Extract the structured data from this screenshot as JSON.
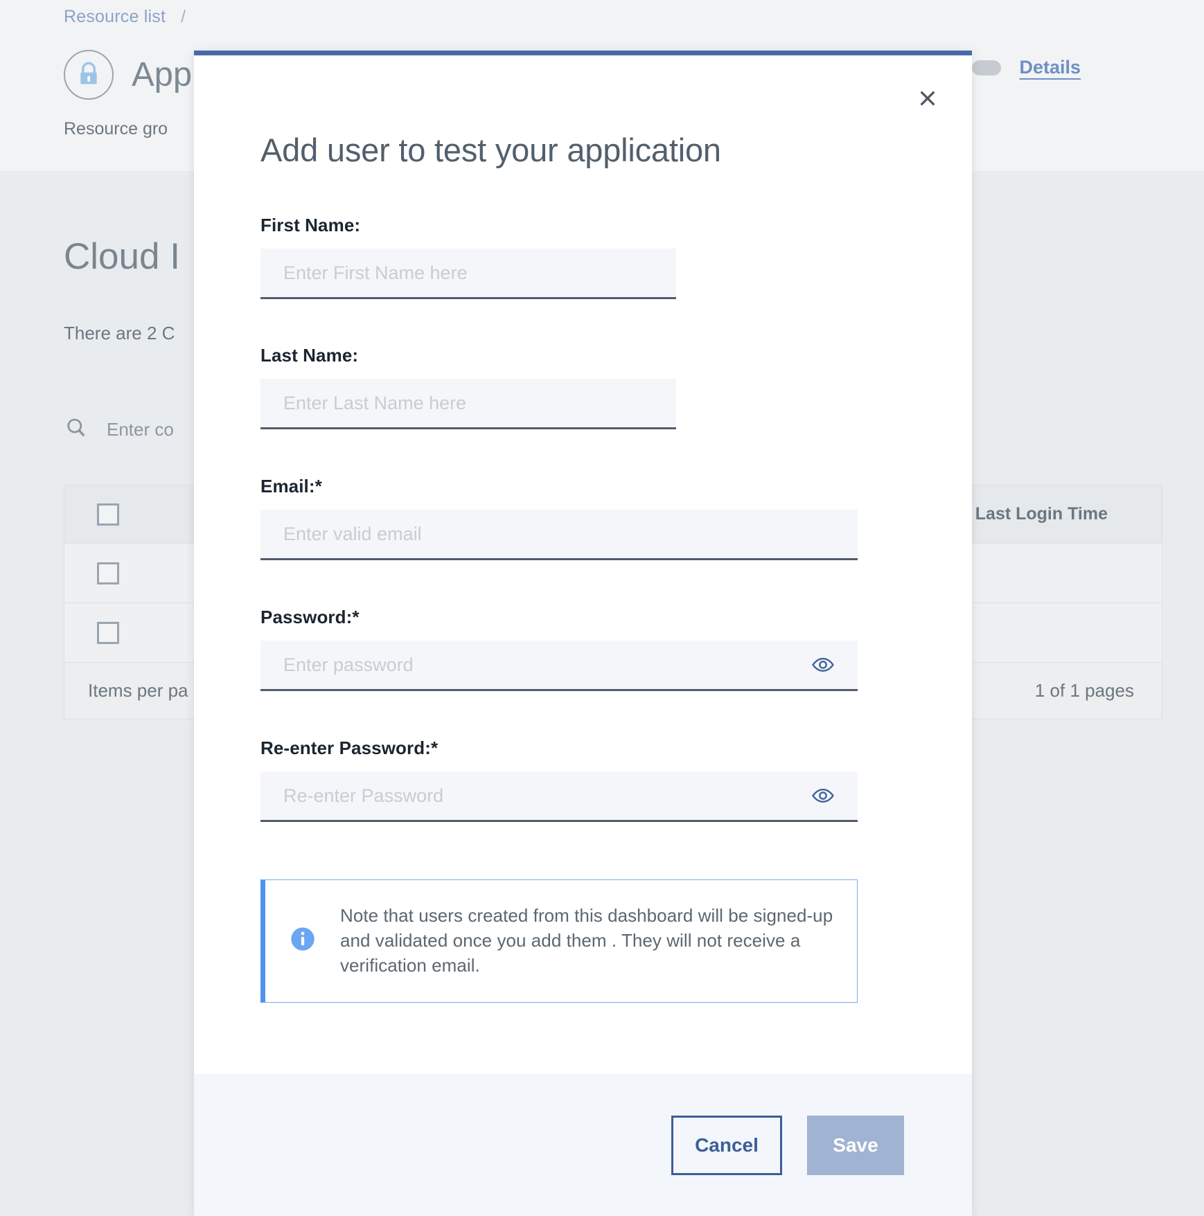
{
  "background": {
    "breadcrumb": {
      "link": "Resource list",
      "separator": "/"
    },
    "resource_title": "App",
    "resource_subtitle": "Resource gro",
    "resource_icon": "lock-icon",
    "details_link": "Details",
    "page_title": "Cloud I",
    "page_description": "There are 2 C",
    "search_placeholder": "Enter co",
    "search_icon": "search-icon",
    "table": {
      "header_column": "Last Login Time",
      "rows": [
        {
          "checkbox": false
        },
        {
          "checkbox": false
        }
      ],
      "footer_left": "Items per pa",
      "footer_right": "1 of 1 pages"
    }
  },
  "modal": {
    "title": "Add user to test your application",
    "close_icon": "close-icon",
    "accent_color": "#486ba8",
    "fields": [
      {
        "label": "First Name:",
        "placeholder": "Enter First Name here",
        "value": "",
        "width": "narrow",
        "type": "text"
      },
      {
        "label": "Last Name:",
        "placeholder": "Enter Last Name here",
        "value": "",
        "width": "narrow",
        "type": "text"
      },
      {
        "label": "Email:*",
        "placeholder": "Enter valid email",
        "value": "",
        "width": "wide",
        "type": "email"
      },
      {
        "label": "Password:*",
        "placeholder": "Enter password",
        "value": "",
        "width": "wide",
        "type": "password",
        "reveal_icon": "eye-icon"
      },
      {
        "label": "Re-enter Password:*",
        "placeholder": "Re-enter Password",
        "value": "",
        "width": "wide",
        "type": "password",
        "reveal_icon": "eye-icon"
      }
    ],
    "note": {
      "icon": "info-icon",
      "text": "Note that users created from this dashboard will be signed-up and validated once you add them . They will not receive a verification email.",
      "accent_color": "#4f93ef"
    },
    "footer": {
      "cancel_label": "Cancel",
      "save_label": "Save",
      "save_disabled": true
    }
  }
}
